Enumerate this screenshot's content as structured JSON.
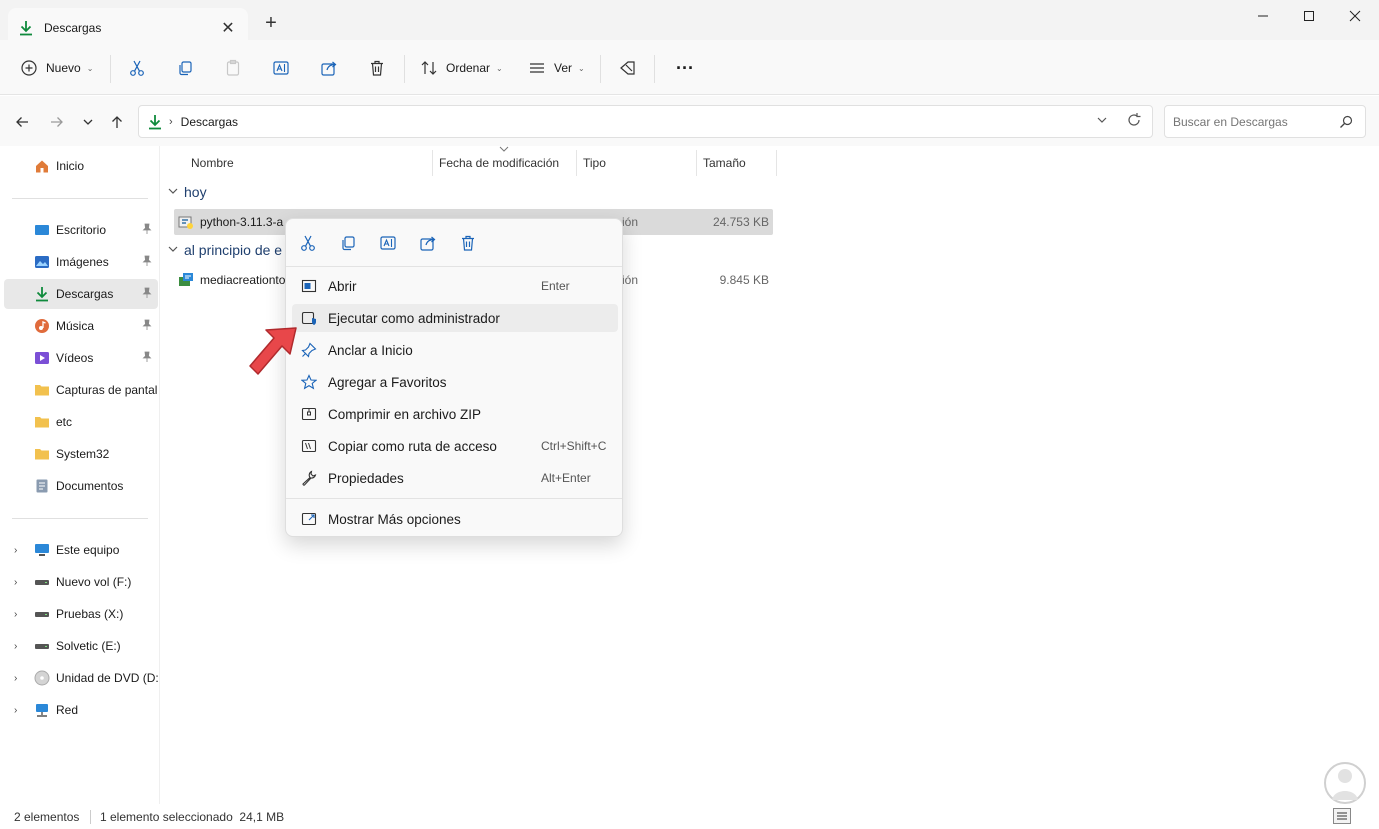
{
  "window": {
    "tab_title": "Descargas",
    "new_tab_symbol": "+",
    "close_tab_symbol": "✕"
  },
  "toolbar": {
    "new_label": "Nuevo",
    "sort_label": "Ordenar",
    "view_label": "Ver",
    "more_label": "···"
  },
  "address": {
    "breadcrumb": "Descargas",
    "search_placeholder": "Buscar en Descargas"
  },
  "sidebar": {
    "home": "Inicio",
    "pinned": [
      {
        "label": "Escritorio",
        "icon": "desktop-icon"
      },
      {
        "label": "Imágenes",
        "icon": "pictures-icon"
      },
      {
        "label": "Descargas",
        "icon": "download-icon"
      },
      {
        "label": "Música",
        "icon": "music-icon"
      },
      {
        "label": "Vídeos",
        "icon": "videos-icon"
      },
      {
        "label": "Capturas de pantall",
        "icon": "folder-icon"
      },
      {
        "label": "etc",
        "icon": "folder-icon"
      },
      {
        "label": "System32",
        "icon": "folder-icon"
      },
      {
        "label": "Documentos",
        "icon": "documents-icon"
      }
    ],
    "drives": [
      {
        "label": "Este equipo",
        "icon": "computer-icon"
      },
      {
        "label": "Nuevo vol (F:)",
        "icon": "drive-icon"
      },
      {
        "label": "Pruebas (X:)",
        "icon": "drive-icon"
      },
      {
        "label": "Solvetic (E:)",
        "icon": "drive-icon"
      },
      {
        "label": "Unidad de DVD (D:)",
        "icon": "dvd-icon"
      },
      {
        "label": "Red",
        "icon": "network-icon"
      }
    ]
  },
  "columns": {
    "name": "Nombre",
    "modified": "Fecha de modificación",
    "type": "Tipo",
    "size": "Tamaño"
  },
  "groups": {
    "today": "hoy",
    "earlier": "al principio de e"
  },
  "files": [
    {
      "name": "python-3.11.3-a",
      "type": "ión",
      "size": "24.753 KB"
    },
    {
      "name": "mediacreationto",
      "type": "ión",
      "size": "9.845 KB"
    }
  ],
  "context_menu": {
    "items": [
      {
        "label": "Abrir",
        "shortcut": "Enter"
      },
      {
        "label": "Ejecutar como administrador",
        "shortcut": ""
      },
      {
        "label": "Anclar a Inicio",
        "shortcut": ""
      },
      {
        "label": "Agregar a Favoritos",
        "shortcut": ""
      },
      {
        "label": "Comprimir en archivo ZIP",
        "shortcut": ""
      },
      {
        "label": "Copiar como ruta de acceso",
        "shortcut": "Ctrl+Shift+C"
      },
      {
        "label": "Propiedades",
        "shortcut": "Alt+Enter"
      }
    ],
    "more_options": "Mostrar Más opciones"
  },
  "status": {
    "count": "2 elementos",
    "selection": "1 elemento seleccionado  24,1 MB"
  },
  "colors": {
    "accent": "#1b64b8",
    "download_green": "#0f8a3c",
    "arrow_red": "#e8474a",
    "folder_yellow": "#f2c14e"
  }
}
